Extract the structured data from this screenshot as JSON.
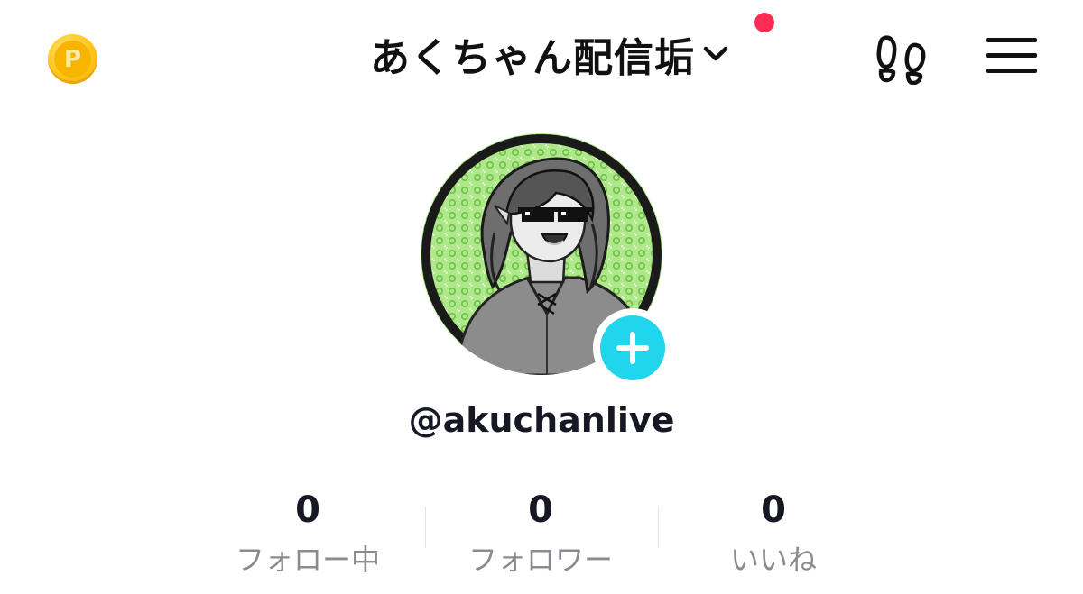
{
  "header": {
    "coin_icon": "coin-p-icon",
    "coin_letter": "P",
    "title": "あくちゃん配信垢",
    "chevron_icon": "chevron-down-icon",
    "notification_color": "#fe2c55",
    "footprints_icon": "footprints-icon",
    "menu_icon": "hamburger-menu-icon"
  },
  "profile": {
    "avatar_icon": "avatar-image",
    "add_icon": "plus-icon",
    "add_color": "#20d5ec",
    "username": "@akuchanlive"
  },
  "stats": [
    {
      "value": "0",
      "label": "フォロー中"
    },
    {
      "value": "0",
      "label": "フォロワー"
    },
    {
      "value": "0",
      "label": "いいね"
    }
  ]
}
